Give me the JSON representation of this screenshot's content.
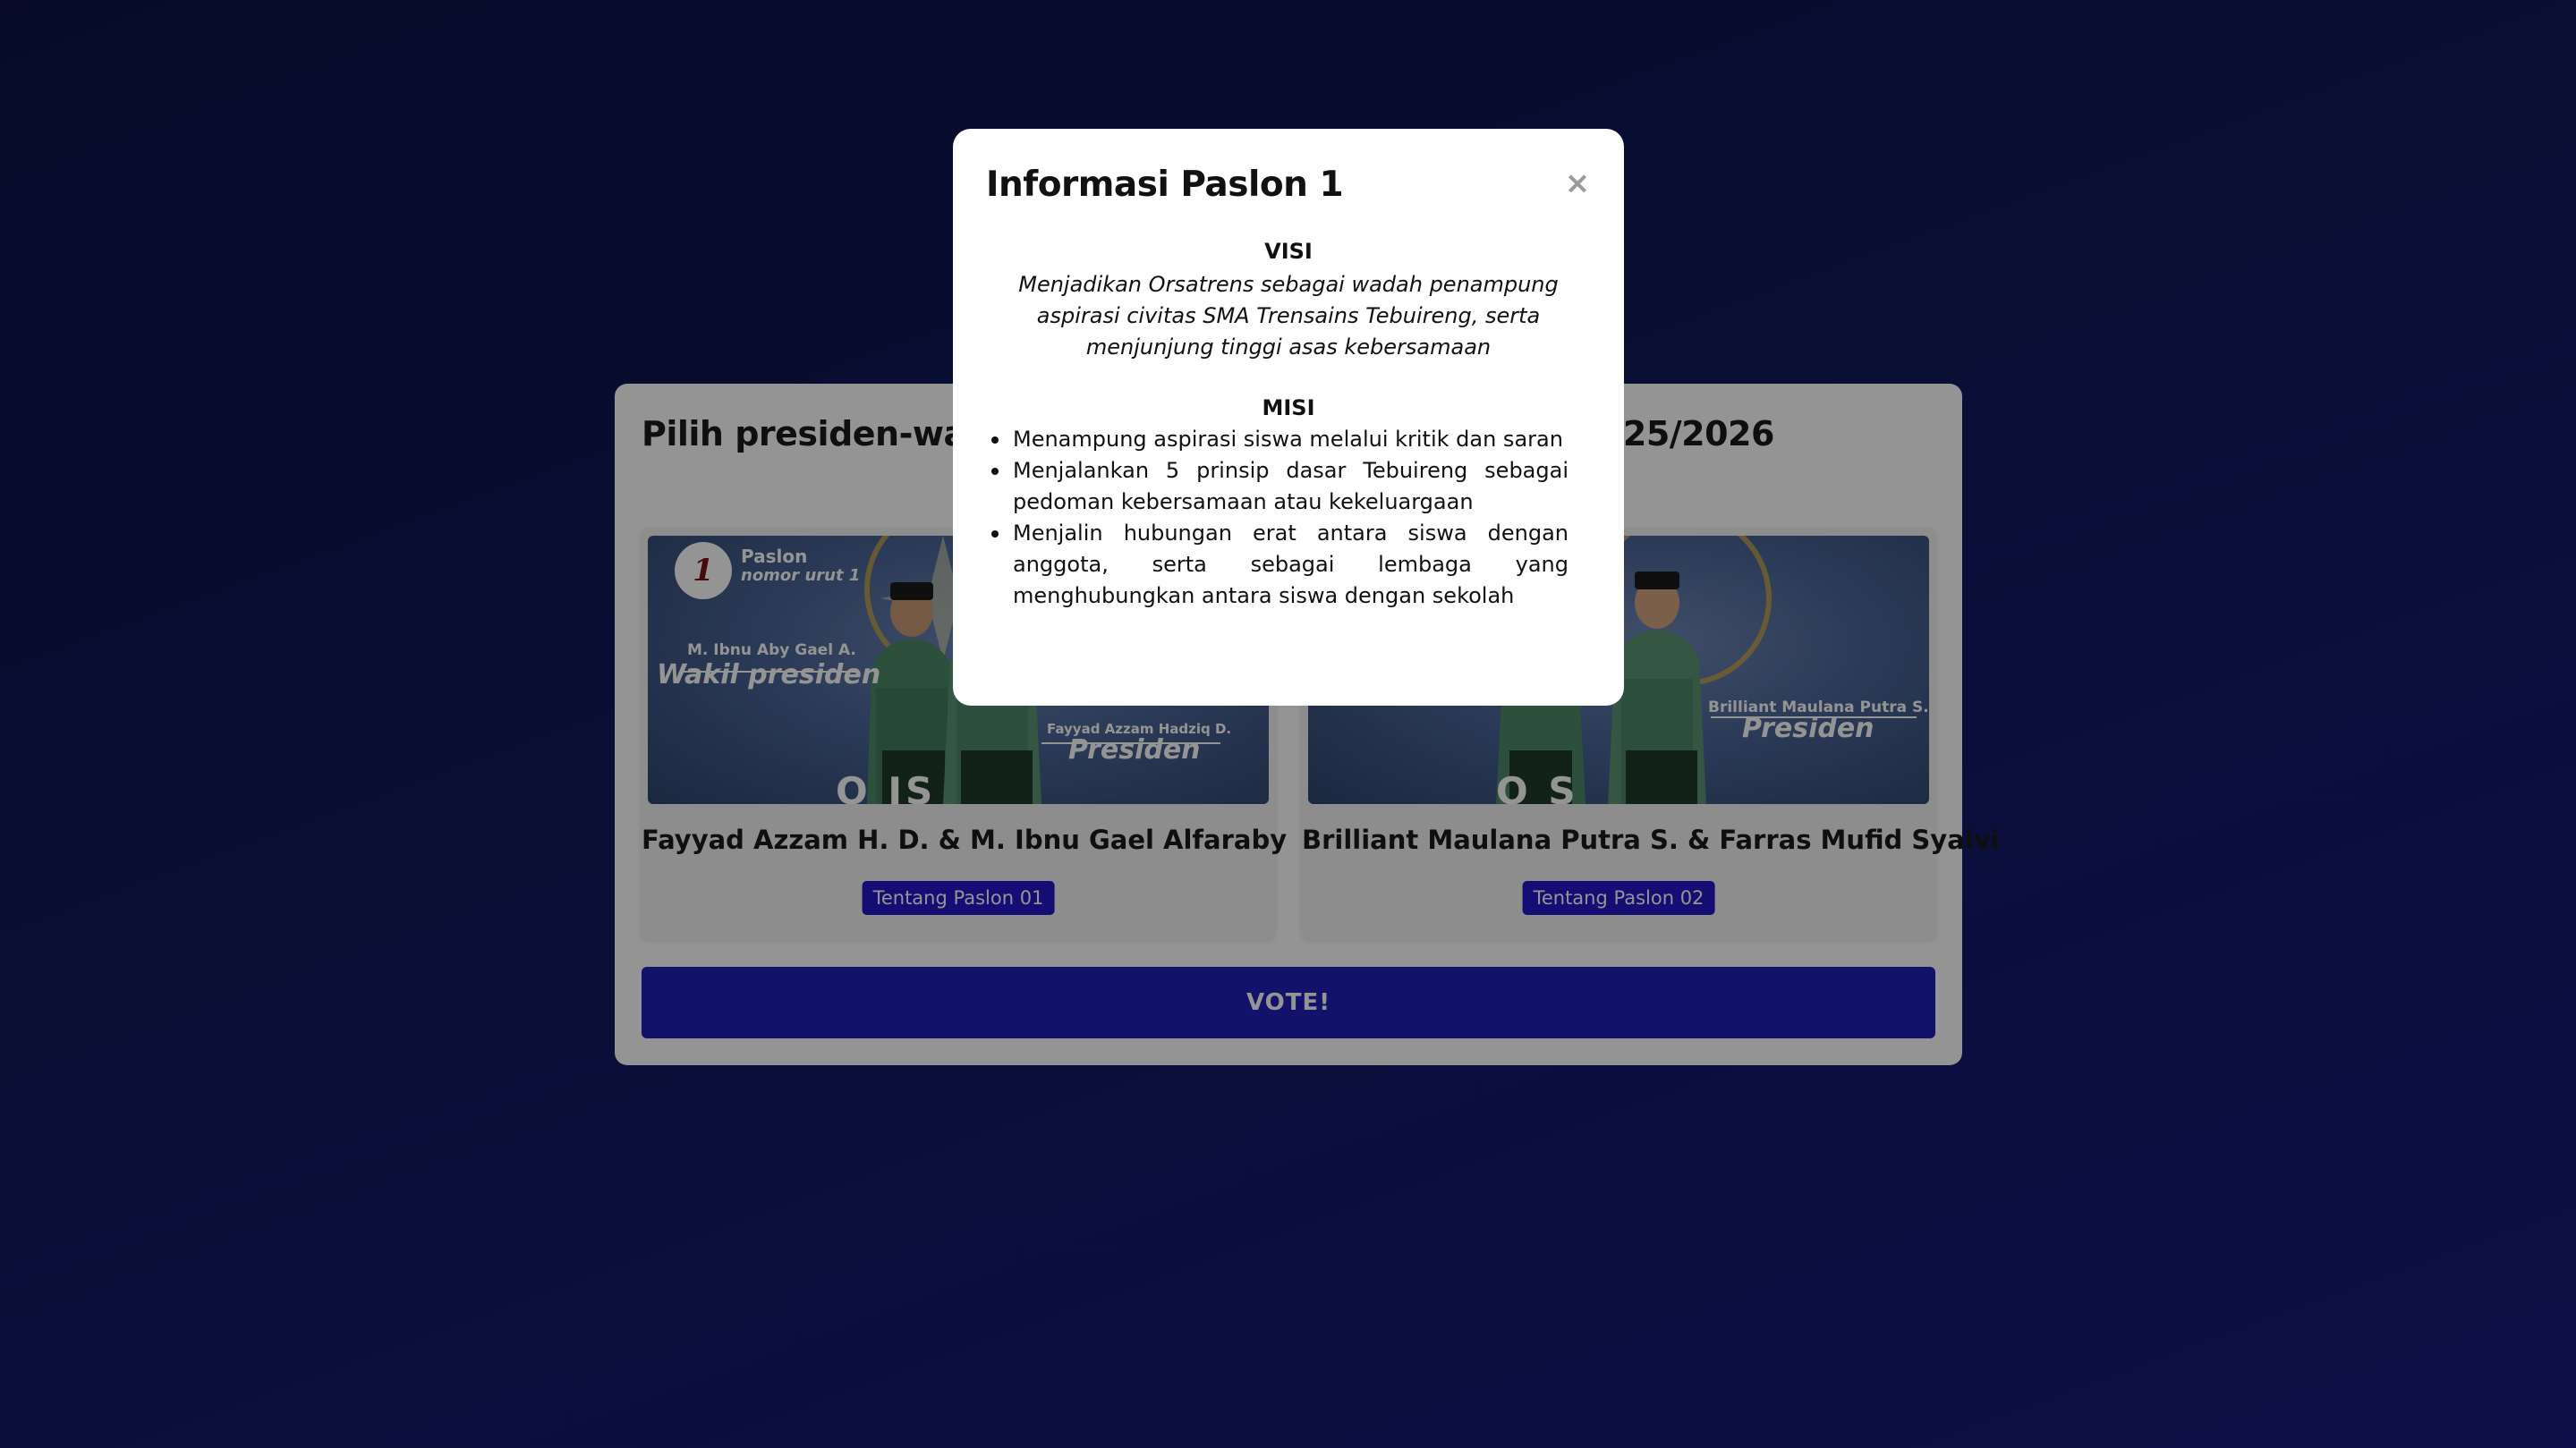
{
  "colors": {
    "background_start": "#0d1448",
    "background_end": "#18197a",
    "accent_button": "#2418c8",
    "vote_button": "#1f20b8"
  },
  "panel": {
    "title": "Pilih presiden-wakil presiden OSIS Masa Khidmat 2025/2026",
    "vote_label": "VOTE!"
  },
  "candidates": [
    {
      "image": {
        "number": "1",
        "paslon_label": "Paslon",
        "paslon_sub": "nomor urut 1",
        "name_a": "M. Ibnu Aby Gael A.",
        "role_a": "Wakil presiden",
        "name_b": "Fayyad Azzam Hadziq D.",
        "role_b": "Presiden",
        "logo_text": "O     IS"
      },
      "name": "Fayyad Azzam H. D. & M. Ibnu Gael Alfaraby",
      "button_label": "Tentang Paslon 01"
    },
    {
      "image": {
        "name_b": "Brilliant Maulana Putra S.",
        "role_b": "Presiden",
        "logo_text": "O     S"
      },
      "name": "Brilliant Maulana Putra S. & Farras Mufid Syaivi",
      "button_label": "Tentang Paslon 02"
    }
  ],
  "modal": {
    "title": "Informasi Paslon 1",
    "close_icon": "×",
    "visi_heading": "VISI",
    "visi_text": "Menjadikan Orsatrens sebagai wadah penampung aspirasi civitas SMA Trensains Tebuireng, serta menjunjung tinggi asas kebersamaan",
    "misi_heading": "MISI",
    "misi_items": [
      "Menampung aspirasi siswa melalui kritik dan saran",
      "Menjalankan 5 prinsip dasar Tebuireng sebagai pedoman kebersamaan atau kekeluargaan",
      "Menjalin hubungan erat antara siswa dengan anggota, serta sebagai lembaga yang menghubungkan antara siswa dengan sekolah"
    ]
  }
}
